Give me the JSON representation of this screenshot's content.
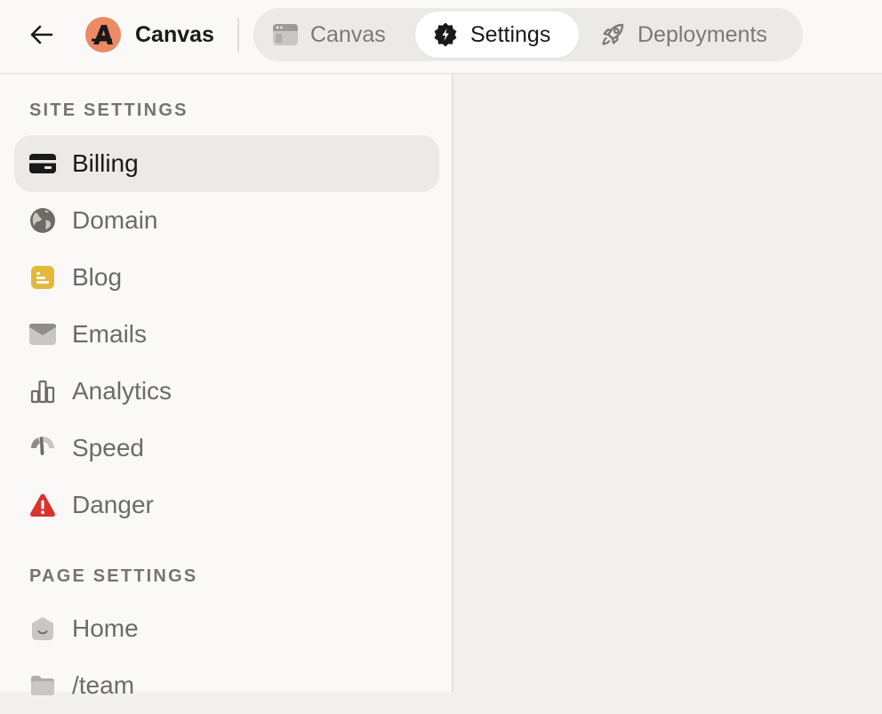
{
  "header": {
    "brand": "Canvas",
    "tabs": [
      {
        "label": "Canvas",
        "icon": "browser-window-icon",
        "active": false
      },
      {
        "label": "Settings",
        "icon": "settings-badge-icon",
        "active": true
      },
      {
        "label": "Deployments",
        "icon": "rocket-icon",
        "active": false
      }
    ]
  },
  "sidebar": {
    "site_section": "SITE SETTINGS",
    "site_items": [
      {
        "label": "Billing",
        "icon": "credit-card-icon",
        "active": true
      },
      {
        "label": "Domain",
        "icon": "globe-icon"
      },
      {
        "label": "Blog",
        "icon": "blog-note-icon"
      },
      {
        "label": "Emails",
        "icon": "envelope-icon"
      },
      {
        "label": "Analytics",
        "icon": "bar-chart-icon"
      },
      {
        "label": "Speed",
        "icon": "speedometer-icon"
      },
      {
        "label": "Danger",
        "icon": "warning-triangle-icon"
      }
    ],
    "page_section": "PAGE SETTINGS",
    "page_items": [
      {
        "label": "Home",
        "icon": "home-icon"
      },
      {
        "label": "/team",
        "icon": "folder-icon"
      }
    ]
  },
  "colors": {
    "logo": "#ec8a66",
    "blog_icon": "#e2b93b",
    "danger_icon": "#d9332b",
    "sidebar_bg": "#faf9f7",
    "content_bg": "#f2f1ee",
    "active_item_bg": "#ebeae7"
  }
}
